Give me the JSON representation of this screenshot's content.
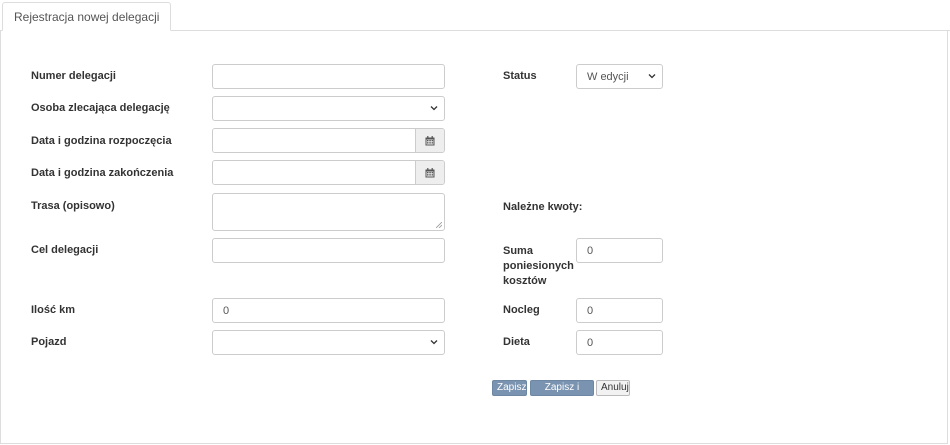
{
  "tab": {
    "label": "Rejestracja nowej delegacji"
  },
  "form": {
    "numer_delegacji": {
      "label": "Numer delegacji",
      "value": ""
    },
    "osoba_zlecajaca": {
      "label": "Osoba zlecająca delegację",
      "value": ""
    },
    "data_rozpoczecia": {
      "label": "Data i godzina rozpoczęcia",
      "value": ""
    },
    "data_zakonczenia": {
      "label": "Data i godzina zakończenia",
      "value": ""
    },
    "trasa": {
      "label": "Trasa (opisowo)",
      "value": ""
    },
    "cel": {
      "label": "Cel delegacji",
      "value": ""
    },
    "ilosc_km": {
      "label": "Ilość km",
      "value": "0"
    },
    "pojazd": {
      "label": "Pojazd",
      "value": ""
    },
    "status": {
      "label": "Status",
      "value": "W edycji"
    },
    "nalezne_kwoty": {
      "label": "Należne kwoty:"
    },
    "suma": {
      "label_line1": "Suma",
      "label_line2": "poniesionych",
      "label_line3": "kosztów",
      "value": "0"
    },
    "nocleg": {
      "label": "Nocleg",
      "value": "0"
    },
    "dieta": {
      "label": "Dieta",
      "value": "0"
    }
  },
  "buttons": {
    "save": "Zapisz",
    "save_exit": "Zapisz i wyjdz",
    "cancel": "Anuluj"
  },
  "icons": {
    "calendar": "calendar-icon",
    "chevron": "chevron-down-icon"
  }
}
